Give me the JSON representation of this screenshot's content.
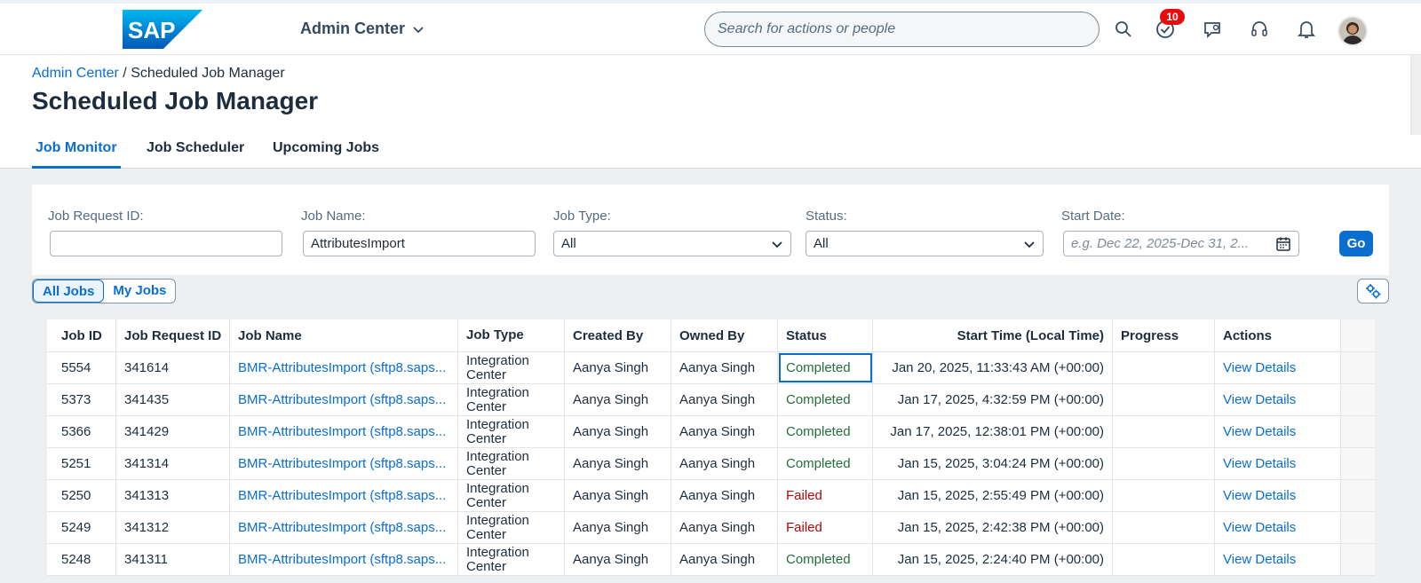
{
  "shell": {
    "logo_text": "SAP",
    "app_title": "Admin Center",
    "search_placeholder": "Search for actions or people",
    "todo_badge": "10",
    "colors": {
      "brand": "#0a6ed1",
      "badge": "#e90b0b"
    }
  },
  "header": {
    "breadcrumb_root": "Admin Center",
    "breadcrumb_sep": "/",
    "breadcrumb_current": "Scheduled Job Manager",
    "title": "Scheduled Job Manager"
  },
  "tabs": [
    {
      "label": "Job Monitor",
      "active": true
    },
    {
      "label": "Job Scheduler",
      "active": false
    },
    {
      "label": "Upcoming Jobs",
      "active": false
    }
  ],
  "filters": {
    "job_request_id": {
      "label": "Job Request ID:",
      "value": ""
    },
    "job_name": {
      "label": "Job Name:",
      "value": "AttributesImport"
    },
    "job_type": {
      "label": "Job Type:",
      "value": "All"
    },
    "status": {
      "label": "Status:",
      "value": "All"
    },
    "start_date": {
      "label": "Start Date:",
      "placeholder": "e.g. Dec 22, 2025-Dec 31, 2..."
    },
    "go_label": "Go"
  },
  "segments": {
    "all": "All Jobs",
    "mine": "My Jobs",
    "selected": "all"
  },
  "table": {
    "columns": [
      "Job ID",
      "Job Request ID",
      "Job Name",
      "Job Type",
      "Created By",
      "Owned By",
      "Status",
      "Start Time (Local Time)",
      "Progress",
      "Actions"
    ],
    "rows": [
      {
        "id": "5554",
        "req": "341614",
        "name": "BMR-AttributesImport (sftp8.saps...",
        "type": "Integration Center",
        "created": "Aanya Singh",
        "owned": "Aanya Singh",
        "status": "Completed",
        "start": "Jan 20, 2025, 11:33:43 AM (+00:00)",
        "progress": "",
        "action": "View Details"
      },
      {
        "id": "5373",
        "req": "341435",
        "name": "BMR-AttributesImport (sftp8.saps...",
        "type": "Integration Center",
        "created": "Aanya Singh",
        "owned": "Aanya Singh",
        "status": "Completed",
        "start": "Jan 17, 2025, 4:32:59 PM (+00:00)",
        "progress": "",
        "action": "View Details"
      },
      {
        "id": "5366",
        "req": "341429",
        "name": "BMR-AttributesImport (sftp8.saps...",
        "type": "Integration Center",
        "created": "Aanya Singh",
        "owned": "Aanya Singh",
        "status": "Completed",
        "start": "Jan 17, 2025, 12:38:01 PM (+00:00)",
        "progress": "",
        "action": "View Details"
      },
      {
        "id": "5251",
        "req": "341314",
        "name": "BMR-AttributesImport (sftp8.saps...",
        "type": "Integration Center",
        "created": "Aanya Singh",
        "owned": "Aanya Singh",
        "status": "Completed",
        "start": "Jan 15, 2025, 3:04:24 PM (+00:00)",
        "progress": "",
        "action": "View Details"
      },
      {
        "id": "5250",
        "req": "341313",
        "name": "BMR-AttributesImport (sftp8.saps...",
        "type": "Integration Center",
        "created": "Aanya Singh",
        "owned": "Aanya Singh",
        "status": "Failed",
        "start": "Jan 15, 2025, 2:55:49 PM (+00:00)",
        "progress": "",
        "action": "View Details"
      },
      {
        "id": "5249",
        "req": "341312",
        "name": "BMR-AttributesImport (sftp8.saps...",
        "type": "Integration Center",
        "created": "Aanya Singh",
        "owned": "Aanya Singh",
        "status": "Failed",
        "start": "Jan 15, 2025, 2:42:38 PM (+00:00)",
        "progress": "",
        "action": "View Details"
      },
      {
        "id": "5248",
        "req": "341311",
        "name": "BMR-AttributesImport (sftp8.saps...",
        "type": "Integration Center",
        "created": "Aanya Singh",
        "owned": "Aanya Singh",
        "status": "Completed",
        "start": "Jan 15, 2025, 2:24:40 PM (+00:00)",
        "progress": "",
        "action": "View Details"
      }
    ]
  }
}
